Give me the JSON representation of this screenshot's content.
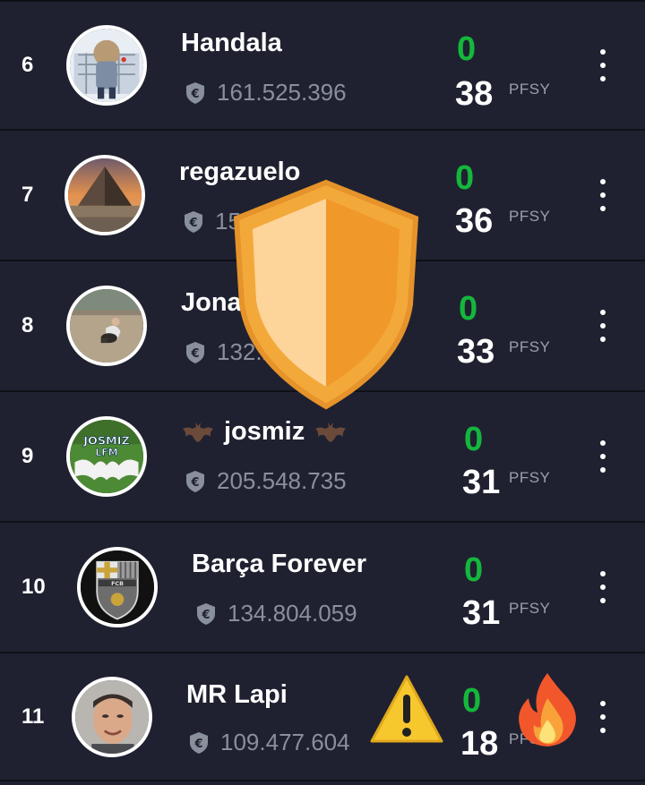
{
  "unit_label": "PFSY",
  "rows": [
    {
      "rank": "6",
      "name": "Handala",
      "money": "161.525.396",
      "delta": "0",
      "points": "38",
      "avatar": "cartoon-character-avatar"
    },
    {
      "rank": "7",
      "name": "regazuelo",
      "money": "15",
      "delta": "0",
      "points": "36",
      "avatar": "pyramid-photo-avatar"
    },
    {
      "rank": "8",
      "name": "Jona",
      "money": "132.2",
      "delta": "0",
      "points": "33",
      "avatar": "person-with-dog-avatar"
    },
    {
      "rank": "9",
      "name": "josmiz",
      "money": "205.548.735",
      "delta": "0",
      "points": "31",
      "avatar": "josmiz-lfm-logo-avatar",
      "avatar_text": [
        "JOSMIZ",
        "LFM"
      ],
      "name_icons": [
        "bat-icon",
        "bat-icon"
      ]
    },
    {
      "rank": "10",
      "name": "Barça Forever",
      "money": "134.804.059",
      "delta": "0",
      "points": "31",
      "avatar": "fcb-crest-avatar",
      "avatar_text": "FCB"
    },
    {
      "rank": "11",
      "name": "MR Lapi",
      "money": "109.477.604",
      "delta": "0",
      "points": "18",
      "avatar": "man-portrait-avatar"
    }
  ],
  "overlays": {
    "shield": "shield-icon",
    "warning": "warning-icon",
    "fire": "fire-icon"
  },
  "colors": {
    "background": "#1f2130",
    "row_divider": "#0f1018",
    "delta_green": "#14b73c",
    "money_gray": "#8a8f9c",
    "shield_orange": "#f0a030"
  }
}
